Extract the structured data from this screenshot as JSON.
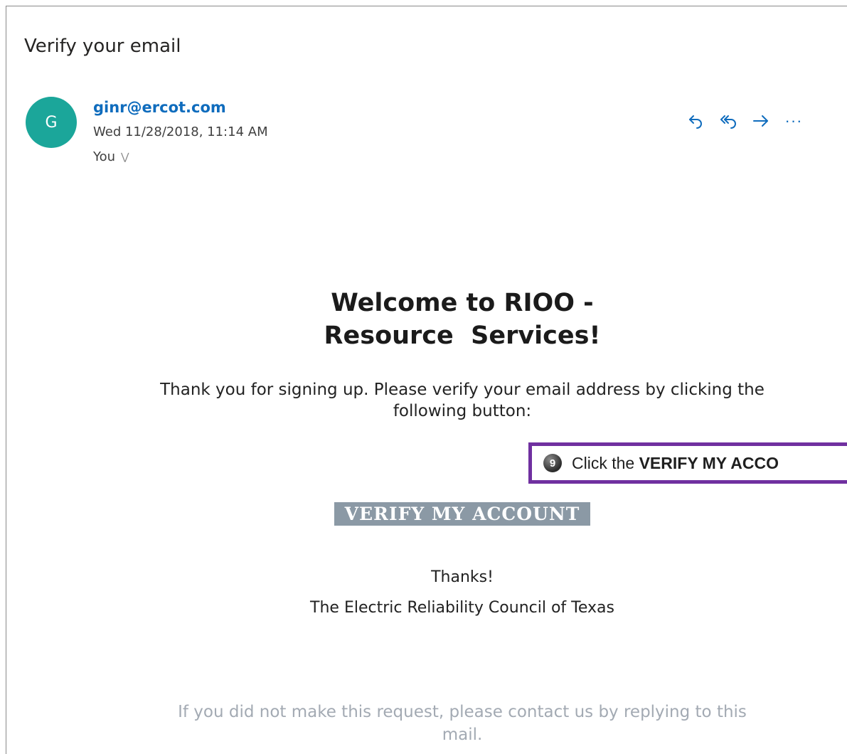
{
  "email": {
    "subject": "Verify your email",
    "avatar_letter": "G",
    "sender": "ginr@ercot.com",
    "datetime": "Wed 11/28/2018, 11:14 AM",
    "recipient": "You",
    "actions": [
      {
        "name": "reply",
        "icon": "reply-icon"
      },
      {
        "name": "reply-all",
        "icon": "reply-all-icon"
      },
      {
        "name": "forward",
        "icon": "forward-icon"
      },
      {
        "name": "more",
        "icon": "more-icon",
        "label": "···"
      }
    ]
  },
  "body": {
    "welcome_line1": "Welcome to RIOO -",
    "welcome_line2": "Resource  Services!",
    "intro_line1": "Thank you for signing up. Please verify your email address by clicking the",
    "intro_line2": "following button:",
    "verify_button": "VERIFY MY ACCOUNT",
    "thanks": "Thanks!",
    "org": "The Electric Reliability Council of Texas",
    "footer_line1": "If you did not make this request, please contact us by replying to this",
    "footer_line2": "mail."
  },
  "callout": {
    "step": "9",
    "text_prefix": "Click the ",
    "text_bold": "VERIFY MY ACCO"
  },
  "colors": {
    "avatar": "#1ba69a",
    "link": "#0f6cbd",
    "callout_border": "#7030a0",
    "verify_button_bg": "#8b99a5",
    "footer_text": "#a3aab3"
  }
}
